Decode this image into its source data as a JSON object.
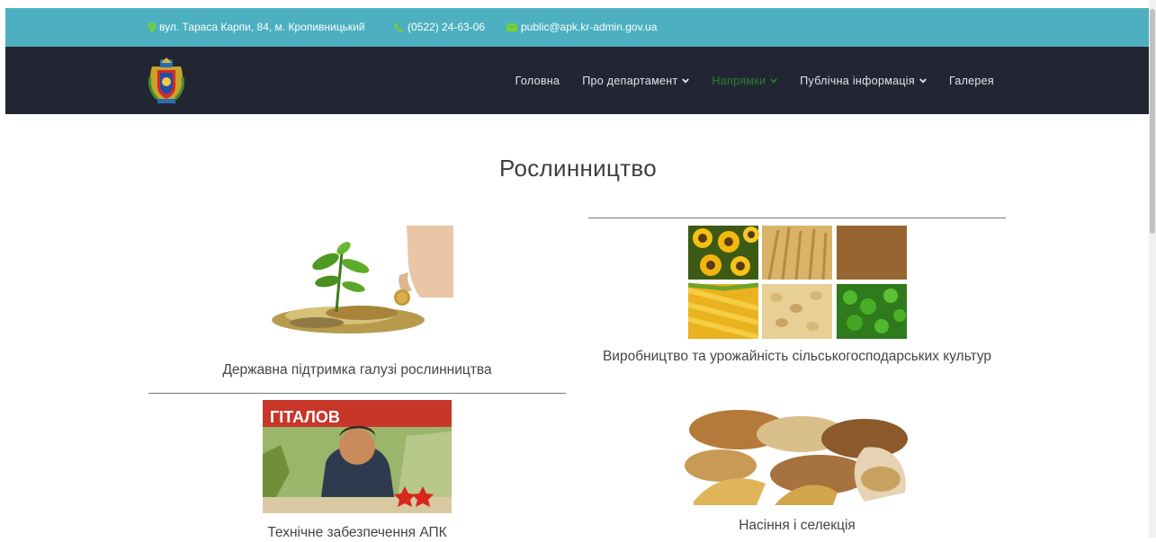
{
  "topbar": {
    "address": "вул. Тараса Карпи, 84, м. Кропивницький",
    "phone": "(0522) 24-63-06",
    "email": "public@apk.kr-admin.gov.ua"
  },
  "nav": {
    "items": [
      {
        "label": "Головна",
        "dropdown": false,
        "active": false
      },
      {
        "label": "Про департамент",
        "dropdown": true,
        "active": false
      },
      {
        "label": "Напрямки",
        "dropdown": true,
        "active": true
      },
      {
        "label": "Публічна інформація",
        "dropdown": true,
        "active": false
      },
      {
        "label": "Галерея",
        "dropdown": false,
        "active": false
      }
    ]
  },
  "page": {
    "title": "Рослинництво"
  },
  "cards": [
    {
      "caption": "Державна підтримка галузі рослинництва",
      "image_icon": "coins-plant-image"
    },
    {
      "caption": "Виробництво та урожайність сільськогосподарських культур",
      "image_icon": "crops-collage-image"
    },
    {
      "caption": "Технічне забезпечення АПК",
      "image_icon": "poster-image",
      "poster_text": "ГІТАЛОВ"
    },
    {
      "caption": "Насіння і селекція",
      "image_icon": "seeds-image"
    }
  ],
  "colors": {
    "topbar": "#4cb0c1",
    "navbar": "#222633",
    "active_nav": "#2f7d30",
    "phone_icon": "#7ed321",
    "email_icon": "#7ed321"
  }
}
